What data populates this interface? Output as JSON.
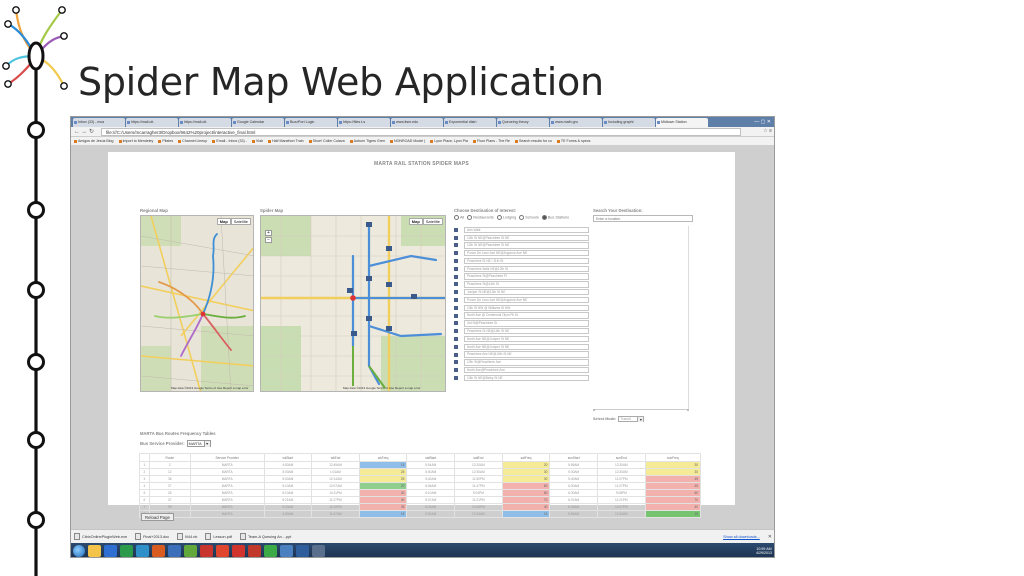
{
  "slide": {
    "title": "Spider Map Web Application",
    "colors": {
      "rail": "#111111",
      "node_fill": "#ffffff",
      "lines": [
        "#f2a33a",
        "#a3c947",
        "#2b8ad8",
        "#d94a4a",
        "#9b59b6",
        "#4dc3e0"
      ]
    }
  },
  "browser": {
    "tabs": [
      "Inbox (33) - mca",
      "https://mail.oit.",
      "https://mail.oit.",
      "Google Calendar",
      "BuzzPort Login",
      "https://files.t-s",
      "www.itsm.edu",
      "Exponential distri",
      "Queueing theory",
      "www.math.gru",
      "Including graphi",
      "Midtown Station"
    ],
    "active_tab": 11,
    "address": "file:///C:/Users/mcarragher3/Dropbox/6642%20project/interactive_final.html",
    "bookmarks": [
      "Amigos de Jesús Blog",
      "Import to Mendeley",
      "Pilates",
      "Channel Lineup",
      "Email - Inbox (33) -",
      "Vlab",
      "Half Marathon Train",
      "Shoe! Coller Culava",
      "Auburn Tigers Gren",
      "NONROAD Model (",
      "Lyon Place, Lyon Pla",
      "Floor Plans - The Re",
      "Search results for cu",
      "TE Forms & specs"
    ]
  },
  "app": {
    "title": "MARTA RAIL STATION SPIDER MAPS",
    "regional_label": "Regional Map",
    "spider_label": "Spider Map",
    "map_type": {
      "map": "Map",
      "satellite": "Satellite"
    },
    "map_footer": "Map data ©2013 Google  Terms of Use  Report a map error",
    "destination_label": "Choose Destination of Interest:",
    "destination_options": [
      "All",
      "Restaurants",
      "Lodging",
      "Schools",
      "Bus Stations"
    ],
    "destination_selected": 4,
    "stops": [
      "Arts Walk",
      "12th St NE@Peachtree St NE",
      "12th St NE@Peachtree St NE",
      "Ponce De Leon Ave NE@Argonne Ave NE",
      "Peachtree St NE / 11th St",
      "Peachtree Walk NE@12th St",
      "Peachtree St@Peachtree Pl",
      "Peachtree St@14th St",
      "Juniper St NE@13th St NE",
      "Ponce De Leon Ave NE@Argonne Ave NE",
      "10th St NW @ Williams St NW",
      "North Ave @ Centennial Olym Pk Dr",
      "3rd St@Peachtree St",
      "Peachtree St NE@14th St NE",
      "North Ave NE@Juniper St NE",
      "North Ave NE@Juniper St NE",
      "Peachtree Ave NE@10th St NE",
      "10th St@Peachtree Ave",
      "North Ave@Peachtree Ave",
      "10th St NE@Bixby St NE"
    ],
    "search_label": "Search Your Destination:",
    "search_placeholder": "Enter a location",
    "mode_label": "Select Mode:",
    "mode_value": "Transit",
    "bus_title": "MARTA Bus Routes Frequency Tables",
    "provider_label": "Bus Service Provider:",
    "provider_value": "MARTA",
    "table": {
      "headers": [
        "",
        "Route",
        "Service Provider",
        "wkStart",
        "wkEnd",
        "wkFreq",
        "satStart",
        "satEnd",
        "satFreq",
        "sunStart",
        "sunEnd",
        "sunFreq"
      ],
      "rows": [
        [
          "1",
          "2",
          "MARTA",
          "4:50AM",
          "12:49AM",
          "15",
          "5:04AM",
          "12:20AM",
          "20",
          "5:56AM",
          "12:30AM",
          "30"
        ],
        [
          "2",
          "12",
          "MARTA",
          "5:00AM",
          "1:01AM",
          "25",
          "5:00AM",
          "12:30AM",
          "30",
          "5:30AM",
          "12:30AM",
          "30"
        ],
        [
          "3",
          "36",
          "MARTA",
          "5:00AM",
          "12:14AM",
          "25",
          "5:40AM",
          "11:50PM",
          "30",
          "5:40AM",
          "11:07PM",
          "45"
        ],
        [
          "4",
          "27",
          "MARTA",
          "5:10AM",
          "12:07AM",
          "20",
          "6:06AM",
          "11:47PM",
          "60",
          "6:30AM",
          "11:07PM",
          "45"
        ],
        [
          "5",
          "26",
          "MARTA",
          "5:10AM",
          "10:11PM",
          "40",
          "6:10AM",
          "9:04PM",
          "60",
          "6:30AM",
          "9:08PM",
          "60"
        ],
        [
          "6",
          "37",
          "MARTA",
          "5:21AM",
          "11:27PM",
          "40",
          "5:37AM",
          "11:21PM",
          "70",
          "6:37AM",
          "11:21PM",
          "70"
        ],
        [
          "7",
          "99",
          "MARTA",
          "5:00AM",
          "11:20PM",
          "35",
          "6:25AM",
          "10:05PM",
          "40",
          "6:26AM",
          "10:07PM",
          "40"
        ],
        [
          "8",
          "110",
          "MARTA",
          "4:50AM",
          "11:47AM",
          "15",
          "5:00AM",
          "12:34AM",
          "15",
          "5:56AM",
          "12:34AM",
          "15"
        ]
      ],
      "freq_colors": {
        "low": "#8fbfe8",
        "mid_green": "#8fce8c",
        "yellow": "#f5ea95",
        "red": "#f3b1ad",
        "green": "#76c46f"
      }
    },
    "reload_label": "Reload Page"
  },
  "downloads": {
    "items": [
      "CitrixOnlinePluginWeb.exe",
      "Final+2013.doc",
      "Ill44.nb",
      "Lesson.pdf",
      "Team-A Queuing An....ppt"
    ],
    "show_all": "Show all downloads..."
  },
  "taskbar": {
    "time": "10:59 AM",
    "date": "4/29/2013",
    "icon_colors": [
      "#f3c34a",
      "#2f6fd1",
      "#2b9a4b",
      "#2f8fc9",
      "#d85b1f",
      "#3c6fb9",
      "#63a83a",
      "#c7352e",
      "#e0452e",
      "#d0342c",
      "#c0392b",
      "#3cab47",
      "#4a7fc0",
      "#2e5f9c",
      "#5a6f8c"
    ]
  }
}
